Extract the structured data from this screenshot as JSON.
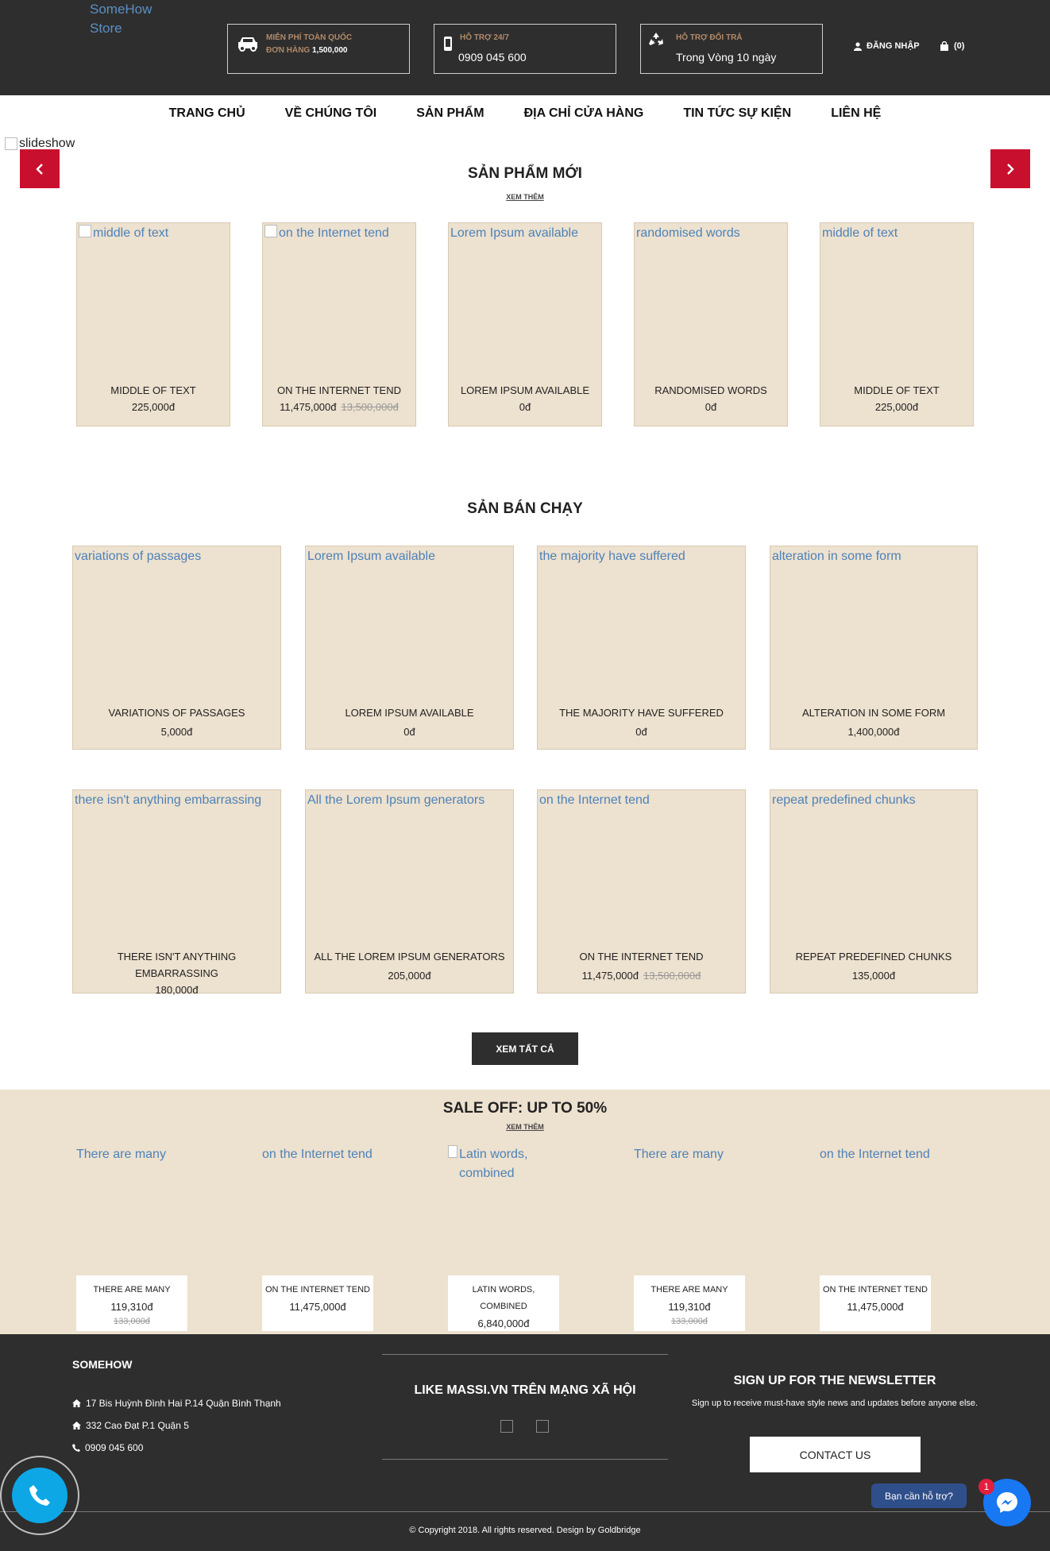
{
  "header": {
    "logo_alt": "SomeHow Store",
    "shipping": {
      "line1": "MIỄN PHÍ TOÀN QUỐC",
      "line2_prefix": "ĐƠN HÀNG ",
      "line2_amount": "1,500,000"
    },
    "support": {
      "label": "HỖ TRỢ 24/7",
      "phone": "0909 045 600"
    },
    "returns": {
      "label": "HỖ TRỢ ĐỔI TRẢ",
      "value": "Trong Vòng 10 ngày"
    },
    "login": "ĐĂNG NHẬP",
    "cart": "(0)"
  },
  "nav": [
    "TRANG CHỦ",
    "VỀ CHÚNG TÔI",
    "SẢN PHẨM",
    "ĐỊA CHỈ CỬA HÀNG",
    "TIN TỨC SỰ KIỆN",
    "LIÊN HỆ"
  ],
  "slideshow_alt": "slideshow",
  "new_products": {
    "title": "SẢN PHẨM MỚI",
    "more": "XEM THÊM",
    "items": [
      {
        "alt": "middle of text",
        "name": "MIDDLE OF TEXT",
        "price": "225,000đ",
        "old": ""
      },
      {
        "alt": "on the Internet tend",
        "name": "ON THE INTERNET TEND",
        "price": "11,475,000đ",
        "old": "13,500,000đ"
      },
      {
        "alt": "Lorem Ipsum available",
        "name": "LOREM IPSUM AVAILABLE",
        "price": "0đ",
        "old": ""
      },
      {
        "alt": "randomised words",
        "name": "RANDOMISED WORDS",
        "price": "0đ",
        "old": ""
      },
      {
        "alt": "middle of text",
        "name": "MIDDLE OF TEXT",
        "price": "225,000đ",
        "old": ""
      }
    ]
  },
  "best_sellers": {
    "title": "SẢN BÁN CHẠY",
    "items": [
      {
        "alt": "variations of passages",
        "name": "VARIATIONS OF PASSAGES",
        "price": "5,000đ",
        "old": ""
      },
      {
        "alt": "Lorem Ipsum available",
        "name": "LOREM IPSUM AVAILABLE",
        "price": "0đ",
        "old": ""
      },
      {
        "alt": "the majority have suffered",
        "name": "THE MAJORITY HAVE SUFFERED",
        "price": "0đ",
        "old": ""
      },
      {
        "alt": "alteration in some form",
        "name": "ALTERATION IN SOME FORM",
        "price": "1,400,000đ",
        "old": ""
      },
      {
        "alt": "there isn't anything embarrassing",
        "name": "THERE ISN'T ANYTHING EMBARRASSING",
        "price": "180,000đ",
        "old": ""
      },
      {
        "alt": "All the Lorem Ipsum generators",
        "name": "ALL THE LOREM IPSUM GENERATORS",
        "price": "205,000đ",
        "old": ""
      },
      {
        "alt": "on the Internet tend",
        "name": "ON THE INTERNET TEND",
        "price": "11,475,000đ",
        "old": "13,500,000đ"
      },
      {
        "alt": "repeat predefined chunks",
        "name": "REPEAT PREDEFINED CHUNKS",
        "price": "135,000đ",
        "old": ""
      }
    ],
    "view_all": "XEM TẤT CẢ"
  },
  "sale": {
    "title": "SALE OFF: UP TO 50%",
    "more": "XEM THÊM",
    "items": [
      {
        "alt": "There are many",
        "name": "THERE ARE MANY",
        "price": "119,310đ",
        "old": "133,000đ"
      },
      {
        "alt": "on the Internet tend",
        "name": "ON THE INTERNET TEND",
        "price": "11,475,000đ",
        "old": ""
      },
      {
        "alt": "Latin words, combined",
        "name": "LATIN WORDS, COMBINED",
        "price": "6,840,000đ",
        "old": ""
      },
      {
        "alt": "There are many",
        "name": "THERE ARE MANY",
        "price": "119,310đ",
        "old": "133,000đ"
      },
      {
        "alt": "on the Internet tend",
        "name": "ON THE INTERNET TEND",
        "price": "11,475,000đ",
        "old": ""
      }
    ]
  },
  "footer": {
    "brand": "SOMEHOW",
    "address1": "17 Bis Huỳnh Đình Hai P.14 Quận Bình Thạnh",
    "address2": "332 Cao Đạt P.1 Quận 5",
    "phone": "0909 045 600",
    "social_title": "LIKE MASSI.VN TRÊN MẠNG XÃ HỘI",
    "newsletter_title": "SIGN UP FOR THE NEWSLETTER",
    "newsletter_sub": "Sign up to receive must-have style news and updates before anyone else.",
    "contact_button": "CONTACT US",
    "copyright": "© Copyright 2018. All rights reserved. Design by Goldbridge"
  },
  "widgets": {
    "help": "Bạn cần hỗ trợ?",
    "badge": "1"
  },
  "colors": {
    "dark": "#2e2e2e",
    "beige": "#ede1cf",
    "accent_red": "#c8102e",
    "link_blue": "#4d82b8",
    "messenger": "#1877f2",
    "phone": "#0da7e6"
  }
}
